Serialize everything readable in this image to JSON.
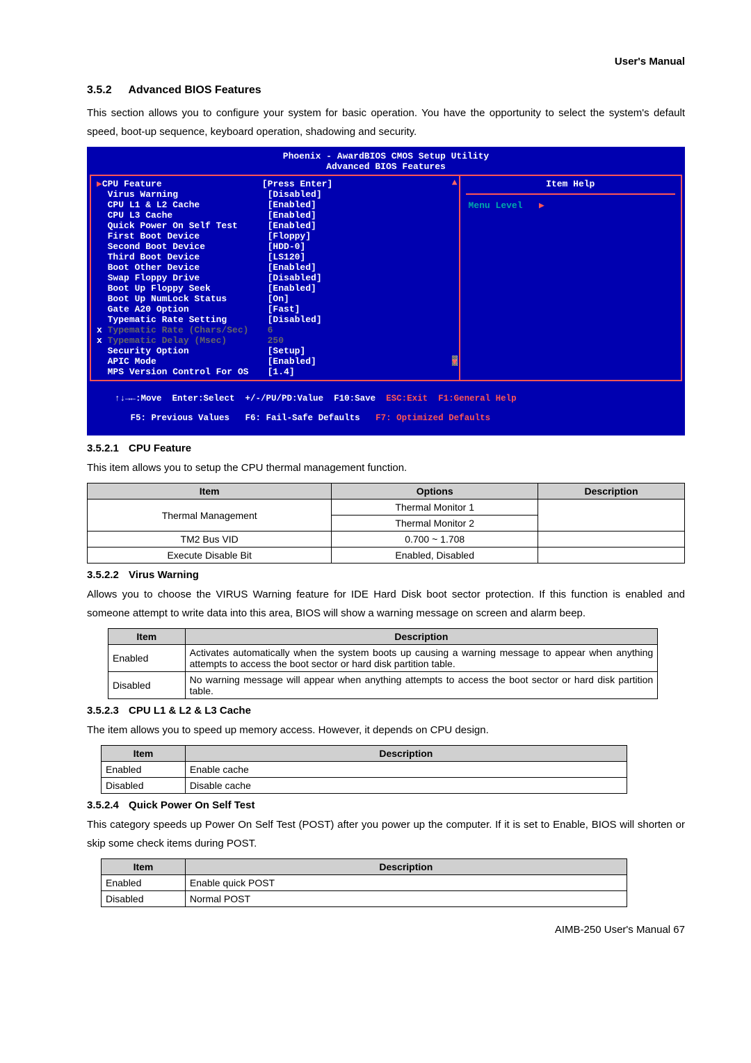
{
  "header_running": "User's Manual",
  "section1": {
    "num": "3.5.2",
    "title": "Advanced BIOS Features",
    "intro": "This section allows you to configure your system for basic operation. You have the opportunity to select the system's default speed, boot-up sequence, keyboard operation, shadowing and security."
  },
  "bios": {
    "title_line1": "Phoenix - AwardBIOS CMOS Setup Utility",
    "title_line2": "Advanced BIOS Features",
    "help_title": "Item Help",
    "menu_level": "Menu Level",
    "menu_tri": "▶",
    "rows": [
      {
        "label": "CPU Feature",
        "value": "[Press Enter]",
        "indent": true,
        "tri": true,
        "white": true
      },
      {
        "label": "Virus Warning",
        "value": "[Disabled]",
        "indent": true,
        "white": true
      },
      {
        "label": "CPU L1 & L2 Cache",
        "value": "[Enabled]",
        "indent": true,
        "white": true
      },
      {
        "label": "CPU L3 Cache",
        "value": "[Enabled]",
        "indent": true,
        "white": true
      },
      {
        "label": "Quick Power On Self Test",
        "value": "[Enabled]",
        "indent": true,
        "white": true
      },
      {
        "label": "First Boot Device",
        "value": "[Floppy]",
        "indent": true,
        "white": true
      },
      {
        "label": "Second Boot Device",
        "value": "[HDD-0]",
        "indent": true,
        "white": true
      },
      {
        "label": "Third Boot Device",
        "value": "[LS120]",
        "indent": true,
        "white": true
      },
      {
        "label": "Boot Other Device",
        "value": "[Enabled]",
        "indent": true,
        "white": true
      },
      {
        "label": "Swap Floppy Drive",
        "value": "[Disabled]",
        "indent": true,
        "white": true
      },
      {
        "label": "Boot Up Floppy Seek",
        "value": "[Enabled]",
        "indent": true,
        "white": true
      },
      {
        "label": "Boot Up NumLock Status",
        "value": "[On]",
        "indent": true,
        "white": true
      },
      {
        "label": "Gate A20 Option",
        "value": "[Fast]",
        "indent": true,
        "white": true
      },
      {
        "label": "Typematic Rate Setting",
        "value": "[Disabled]",
        "indent": true,
        "white": true
      },
      {
        "label": "Typematic Rate (Chars/Sec)",
        "value": "6",
        "indent": false,
        "gray": true,
        "x": true
      },
      {
        "label": "Typematic Delay (Msec)",
        "value": "250",
        "indent": false,
        "gray": true,
        "x": true
      },
      {
        "label": "Security Option",
        "value": "[Setup]",
        "indent": true,
        "white": true
      },
      {
        "label": "APIC Mode",
        "value": "[Enabled]",
        "indent": true,
        "white": true
      },
      {
        "label": "MPS Version Control For OS",
        "value": "[1.4]",
        "indent": true,
        "white": true
      }
    ],
    "footer1_left": "↑↓→←:Move  Enter:Select  +/-/PU/PD:Value  F10:Save",
    "footer1_right": "  ESC:Exit  F1:General Help",
    "footer2_left": "   F5: Previous Values   F6: Fail-Safe Defaults",
    "footer2_right": "   F7: Optimized Defaults"
  },
  "sec_cpu": {
    "num": "3.5.2.1",
    "title": "CPU Feature",
    "intro": "This item allows you to setup the CPU thermal management function.",
    "headers": [
      "Item",
      "Options",
      "Description"
    ],
    "rows": [
      [
        "Thermal Management",
        "Thermal Monitor 1\nThermal Monitor 2",
        ""
      ],
      [
        "TM2 Bus VID",
        "0.700 ~ 1.708",
        ""
      ],
      [
        "Execute Disable Bit",
        "Enabled, Disabled",
        ""
      ]
    ]
  },
  "sec_virus": {
    "num": "3.5.2.2",
    "title": "Virus Warning",
    "intro": "Allows you to choose the VIRUS Warning feature for IDE Hard Disk boot sector protection. If this function is enabled and someone attempt to write data into this area, BIOS will show a warning message on screen and alarm beep.",
    "headers": [
      "Item",
      "Description"
    ],
    "rows": [
      [
        "Enabled",
        "Activates automatically when the system boots up causing a warning message to appear when anything attempts to access the boot sector or hard disk partition table."
      ],
      [
        "Disabled",
        "No warning message will appear when anything attempts to access the boot sector or hard disk partition table."
      ]
    ]
  },
  "sec_cache": {
    "num": "3.5.2.3",
    "title": "CPU L1 & L2 & L3 Cache",
    "intro": "The item allows you to speed up memory access. However, it depends on CPU design.",
    "headers": [
      "Item",
      "Description"
    ],
    "rows": [
      [
        "Enabled",
        "Enable cache"
      ],
      [
        "Disabled",
        "Disable cache"
      ]
    ]
  },
  "sec_post": {
    "num": "3.5.2.4",
    "title": "Quick Power On Self Test",
    "intro": "This category speeds up Power On Self Test (POST) after you power up the computer. If it is set to Enable, BIOS will shorten or skip some check items during POST.",
    "headers": [
      "Item",
      "Description"
    ],
    "rows": [
      [
        "Enabled",
        "Enable quick POST"
      ],
      [
        "Disabled",
        "Normal POST"
      ]
    ]
  },
  "footer_page": "AIMB-250  User's Manual 67"
}
